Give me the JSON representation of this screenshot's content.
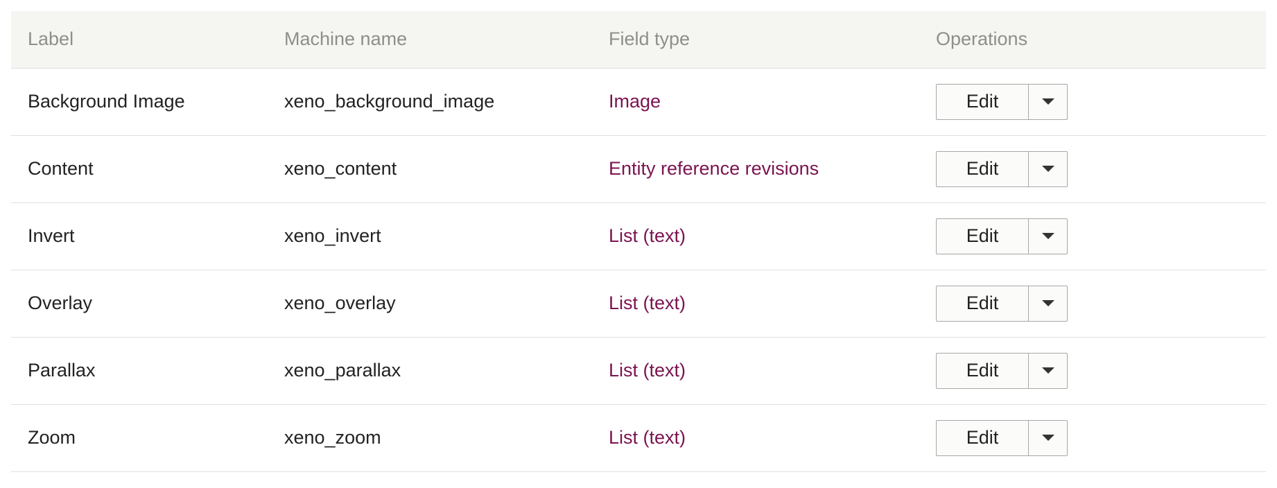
{
  "table": {
    "headers": {
      "label": "Label",
      "machine_name": "Machine name",
      "field_type": "Field type",
      "operations": "Operations"
    },
    "rows": [
      {
        "label": "Background Image",
        "machine_name": "xeno_background_image",
        "field_type": "Image",
        "edit": "Edit"
      },
      {
        "label": "Content",
        "machine_name": "xeno_content",
        "field_type": "Entity reference revisions",
        "edit": "Edit"
      },
      {
        "label": "Invert",
        "machine_name": "xeno_invert",
        "field_type": "List (text)",
        "edit": "Edit"
      },
      {
        "label": "Overlay",
        "machine_name": "xeno_overlay",
        "field_type": "List (text)",
        "edit": "Edit"
      },
      {
        "label": "Parallax",
        "machine_name": "xeno_parallax",
        "field_type": "List (text)",
        "edit": "Edit"
      },
      {
        "label": "Zoom",
        "machine_name": "xeno_zoom",
        "field_type": "List (text)",
        "edit": "Edit"
      }
    ]
  },
  "colors": {
    "header_bg": "#f5f5f2",
    "header_text": "#8e8e8e",
    "link": "#7a1450",
    "border": "#e0e0dc"
  },
  "icons": {
    "dropdown_toggle": "caret-down-icon"
  }
}
